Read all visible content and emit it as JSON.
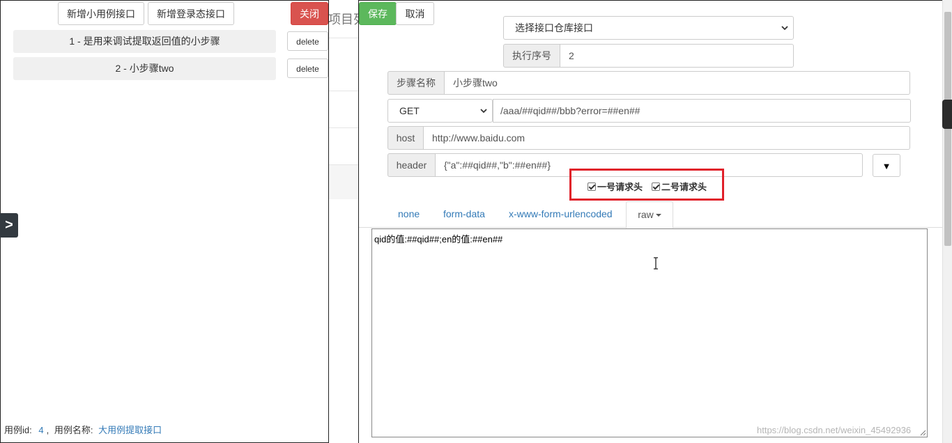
{
  "background": {
    "title_fragment": "项目列"
  },
  "left_panel": {
    "add_case_button": "新增小用例接口",
    "add_login_button": "新增登录态接口",
    "close_button": "关闭",
    "steps": [
      {
        "label": "1 - 是用来调试提取返回值的小步骤",
        "delete_label": "delete"
      },
      {
        "label": "2 - 小步骤two",
        "delete_label": "delete"
      }
    ],
    "footer": {
      "id_label": "用例id:",
      "id_value": "4",
      "sep": ",",
      "name_label": "用例名称:",
      "name_value": "大用例提取接口"
    },
    "side_toggle": ">"
  },
  "right_panel": {
    "save_button": "保存",
    "cancel_button": "取消",
    "repo_select": "选择接口仓库接口",
    "order": {
      "label": "执行序号",
      "value": "2"
    },
    "step_name": {
      "label": "步骤名称",
      "value": "小步骤two"
    },
    "method": "GET",
    "url": "/aaa/##qid##/bbb?error=##en##",
    "host": {
      "label": "host",
      "value": "http://www.baidu.com"
    },
    "header": {
      "label": "header",
      "value": "{\"a\":##qid##,\"b\":##en##}"
    },
    "header_dropdown": "▼",
    "header_presets": [
      {
        "label": "一号请求头",
        "checked": true
      },
      {
        "label": "二号请求头",
        "checked": true
      }
    ],
    "body_tabs": [
      "none",
      "form-data",
      "x-www-form-urlencoded"
    ],
    "active_tab": "raw",
    "body_text": "qid的值:##qid##;en的值:##en##",
    "highlight_color": "#e0202a"
  },
  "watermark": "https://blog.csdn.net/weixin_45492936"
}
